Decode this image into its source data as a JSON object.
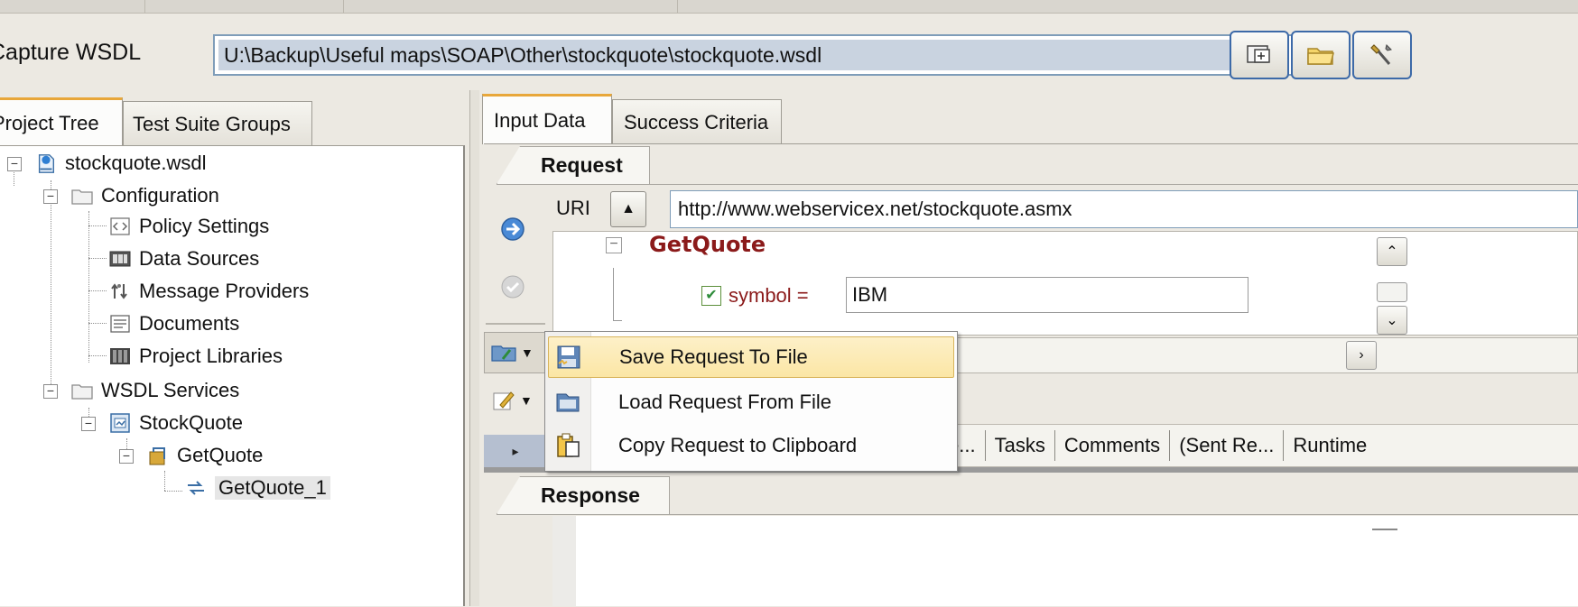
{
  "capture": {
    "label": "Capture WSDL",
    "wsdl_path": "U:\\Backup\\Useful maps\\SOAP\\Other\\stockquote\\stockquote.wsdl",
    "toolbar_icons": [
      "refresh-icon",
      "open-folder-icon",
      "tools-icon"
    ]
  },
  "left_tabs": [
    {
      "label": "Project Tree"
    },
    {
      "label": "Test Suite Groups"
    }
  ],
  "tree": {
    "root": "stockquote.wsdl",
    "configuration": "Configuration",
    "policy_settings": "Policy Settings",
    "data_sources": "Data Sources",
    "message_providers": "Message Providers",
    "documents": "Documents",
    "project_libraries": "Project Libraries",
    "wsdl_services": "WSDL Services",
    "stockquote": "StockQuote",
    "getquote": "GetQuote",
    "getquote_1": "GetQuote_1"
  },
  "right_tabs": [
    {
      "label": "Input Data"
    },
    {
      "label": "Success Criteria"
    }
  ],
  "request": {
    "section_label": "Request",
    "uri_label": "URI",
    "uri_value": "http://www.webservicex.net/stockquote.asmx",
    "operation": "GetQuote",
    "param_name": "symbol =",
    "param_value": "IBM"
  },
  "context_menu": {
    "items": [
      {
        "label": "Save Request To File",
        "icon": "save-file-icon",
        "highlighted": true
      },
      {
        "label": "Load Request From File",
        "icon": "load-file-icon",
        "highlighted": false
      },
      {
        "label": "Copy Request to Clipboard",
        "icon": "clipboard-icon",
        "highlighted": false
      }
    ]
  },
  "bottom_tabs": [
    {
      "label": "e..."
    },
    {
      "label": "Tasks"
    },
    {
      "label": "Comments"
    },
    {
      "label": "(Sent Re..."
    },
    {
      "label": "Runtime"
    }
  ],
  "response": {
    "section_label": "Response"
  },
  "colors": {
    "tab_accent": "#e8a73a",
    "selection": "#c9d3e0",
    "operation_text": "#8b1a1a",
    "menu_highlight": "#fbe6a5"
  }
}
